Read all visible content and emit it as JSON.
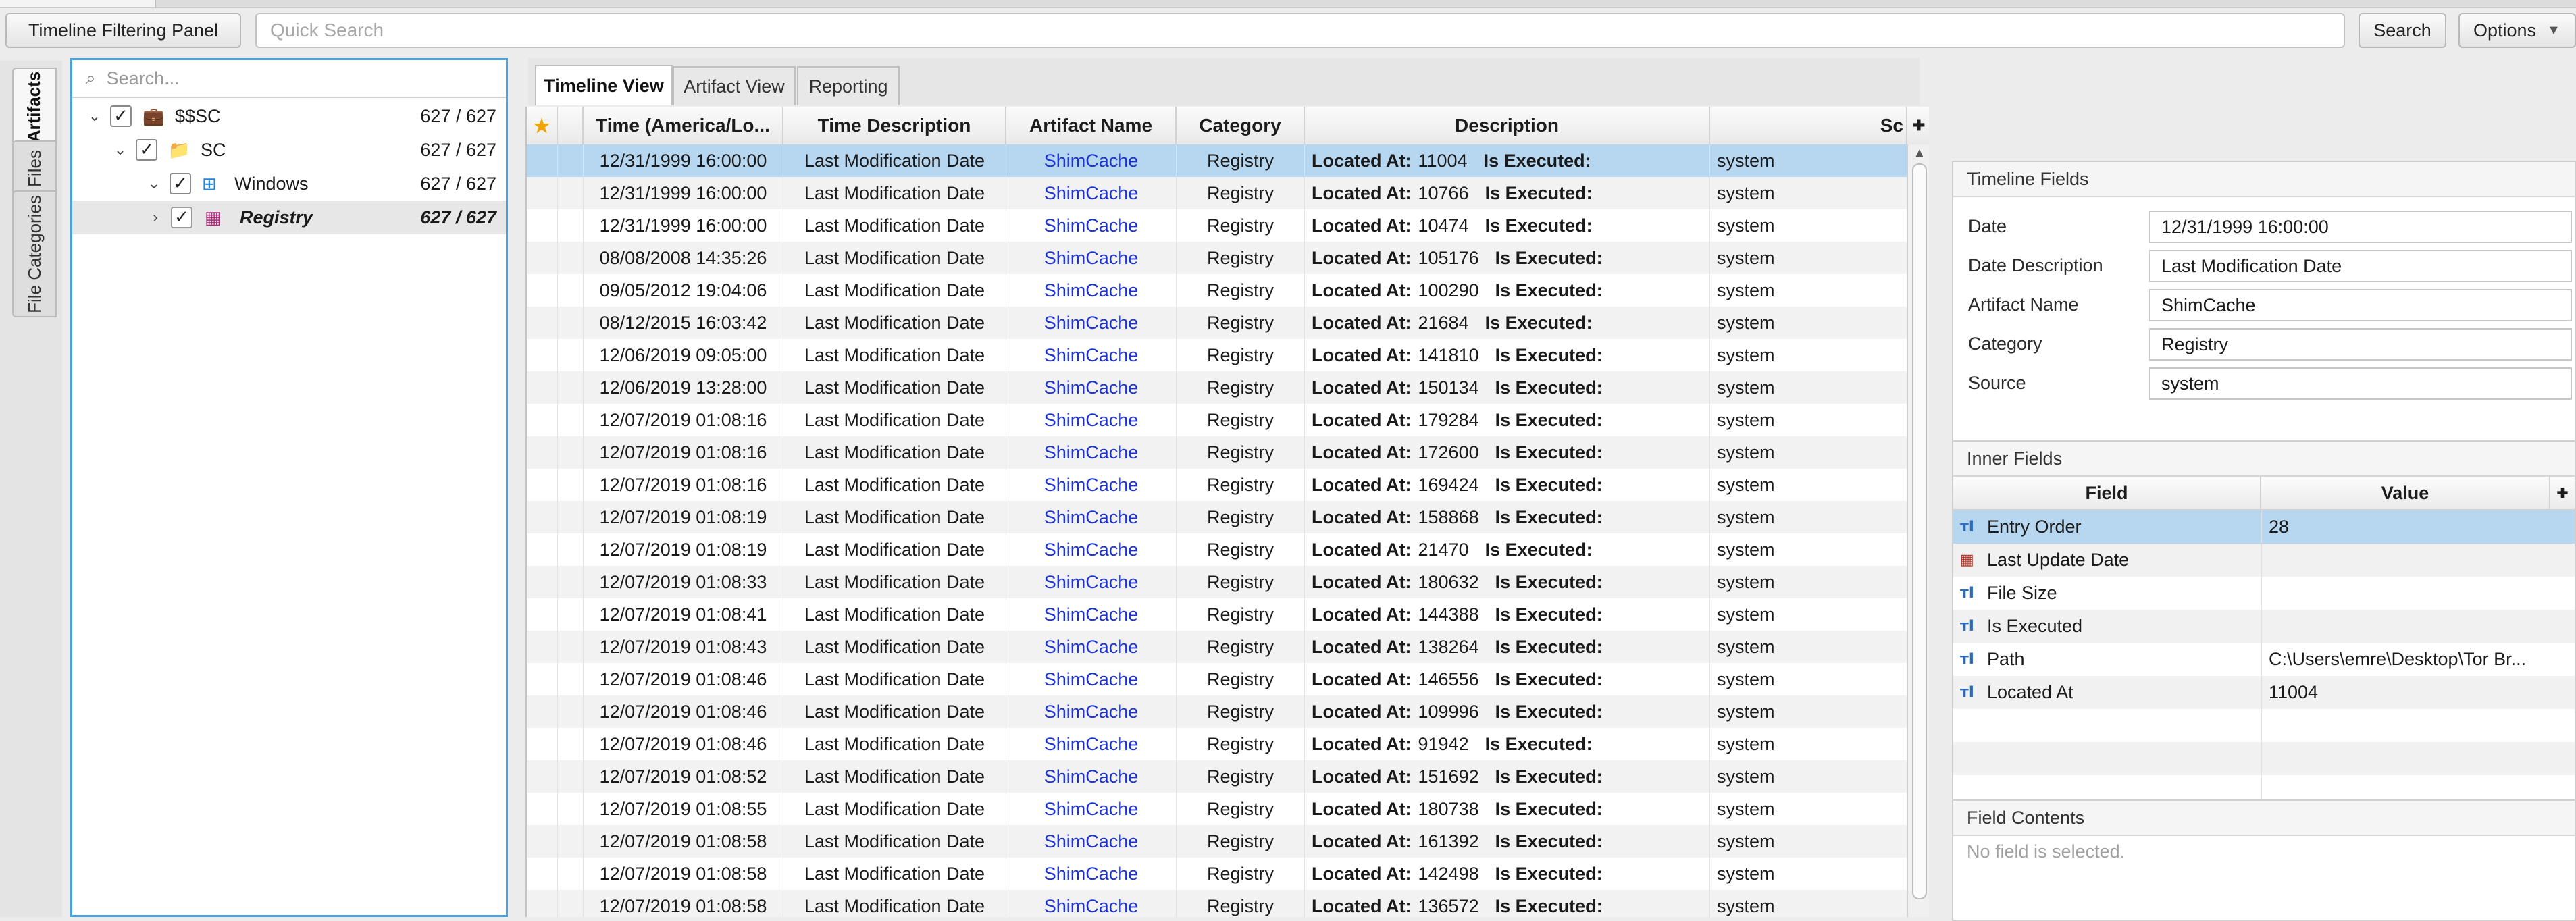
{
  "toolbar": {
    "filter_panel_label": "Timeline Filtering Panel",
    "quick_search_placeholder": "Quick Search",
    "search_label": "Search",
    "options_label": "Options"
  },
  "side_tabs": [
    "Artifacts",
    "Files",
    "File Categories"
  ],
  "tree": {
    "search_placeholder": "Search...",
    "items": [
      {
        "label": "$$SC",
        "count": "627 / 627",
        "icon": "briefcase-icon"
      },
      {
        "label": "SC",
        "count": "627 / 627",
        "icon": "folder-icon"
      },
      {
        "label": "Windows",
        "count": "627 / 627",
        "icon": "windows-logo-icon"
      },
      {
        "label": "Registry",
        "count": "627 / 627",
        "icon": "registry-icon"
      }
    ]
  },
  "center_tabs": [
    "Timeline View",
    "Artifact View",
    "Reporting"
  ],
  "table": {
    "columns": [
      "Time (America/Lo...",
      "Time Description",
      "Artifact Name",
      "Category",
      "Description",
      "Sc"
    ],
    "desc_label_located": "Located At:",
    "desc_label_executed": "Is Executed:",
    "rows": [
      {
        "time": "12/31/1999 16:00:00",
        "tdesc": "Last Modification Date",
        "artifact": "ShimCache",
        "category": "Registry",
        "located": "11004",
        "source": "system"
      },
      {
        "time": "12/31/1999 16:00:00",
        "tdesc": "Last Modification Date",
        "artifact": "ShimCache",
        "category": "Registry",
        "located": "10766",
        "source": "system"
      },
      {
        "time": "12/31/1999 16:00:00",
        "tdesc": "Last Modification Date",
        "artifact": "ShimCache",
        "category": "Registry",
        "located": "10474",
        "source": "system"
      },
      {
        "time": "08/08/2008 14:35:26",
        "tdesc": "Last Modification Date",
        "artifact": "ShimCache",
        "category": "Registry",
        "located": "105176",
        "source": "system"
      },
      {
        "time": "09/05/2012 19:04:06",
        "tdesc": "Last Modification Date",
        "artifact": "ShimCache",
        "category": "Registry",
        "located": "100290",
        "source": "system"
      },
      {
        "time": "08/12/2015 16:03:42",
        "tdesc": "Last Modification Date",
        "artifact": "ShimCache",
        "category": "Registry",
        "located": "21684",
        "source": "system"
      },
      {
        "time": "12/06/2019 09:05:00",
        "tdesc": "Last Modification Date",
        "artifact": "ShimCache",
        "category": "Registry",
        "located": "141810",
        "source": "system"
      },
      {
        "time": "12/06/2019 13:28:00",
        "tdesc": "Last Modification Date",
        "artifact": "ShimCache",
        "category": "Registry",
        "located": "150134",
        "source": "system"
      },
      {
        "time": "12/07/2019 01:08:16",
        "tdesc": "Last Modification Date",
        "artifact": "ShimCache",
        "category": "Registry",
        "located": "179284",
        "source": "system"
      },
      {
        "time": "12/07/2019 01:08:16",
        "tdesc": "Last Modification Date",
        "artifact": "ShimCache",
        "category": "Registry",
        "located": "172600",
        "source": "system"
      },
      {
        "time": "12/07/2019 01:08:16",
        "tdesc": "Last Modification Date",
        "artifact": "ShimCache",
        "category": "Registry",
        "located": "169424",
        "source": "system"
      },
      {
        "time": "12/07/2019 01:08:19",
        "tdesc": "Last Modification Date",
        "artifact": "ShimCache",
        "category": "Registry",
        "located": "158868",
        "source": "system"
      },
      {
        "time": "12/07/2019 01:08:19",
        "tdesc": "Last Modification Date",
        "artifact": "ShimCache",
        "category": "Registry",
        "located": "21470",
        "source": "system"
      },
      {
        "time": "12/07/2019 01:08:33",
        "tdesc": "Last Modification Date",
        "artifact": "ShimCache",
        "category": "Registry",
        "located": "180632",
        "source": "system"
      },
      {
        "time": "12/07/2019 01:08:41",
        "tdesc": "Last Modification Date",
        "artifact": "ShimCache",
        "category": "Registry",
        "located": "144388",
        "source": "system"
      },
      {
        "time": "12/07/2019 01:08:43",
        "tdesc": "Last Modification Date",
        "artifact": "ShimCache",
        "category": "Registry",
        "located": "138264",
        "source": "system"
      },
      {
        "time": "12/07/2019 01:08:46",
        "tdesc": "Last Modification Date",
        "artifact": "ShimCache",
        "category": "Registry",
        "located": "146556",
        "source": "system"
      },
      {
        "time": "12/07/2019 01:08:46",
        "tdesc": "Last Modification Date",
        "artifact": "ShimCache",
        "category": "Registry",
        "located": "109996",
        "source": "system"
      },
      {
        "time": "12/07/2019 01:08:46",
        "tdesc": "Last Modification Date",
        "artifact": "ShimCache",
        "category": "Registry",
        "located": "91942",
        "source": "system"
      },
      {
        "time": "12/07/2019 01:08:52",
        "tdesc": "Last Modification Date",
        "artifact": "ShimCache",
        "category": "Registry",
        "located": "151692",
        "source": "system"
      },
      {
        "time": "12/07/2019 01:08:55",
        "tdesc": "Last Modification Date",
        "artifact": "ShimCache",
        "category": "Registry",
        "located": "180738",
        "source": "system"
      },
      {
        "time": "12/07/2019 01:08:58",
        "tdesc": "Last Modification Date",
        "artifact": "ShimCache",
        "category": "Registry",
        "located": "161392",
        "source": "system"
      },
      {
        "time": "12/07/2019 01:08:58",
        "tdesc": "Last Modification Date",
        "artifact": "ShimCache",
        "category": "Registry",
        "located": "142498",
        "source": "system"
      },
      {
        "time": "12/07/2019 01:08:58",
        "tdesc": "Last Modification Date",
        "artifact": "ShimCache",
        "category": "Registry",
        "located": "136572",
        "source": "system"
      }
    ]
  },
  "timeline_fields": {
    "title": "Timeline Fields",
    "fields": [
      {
        "label": "Date",
        "value": "12/31/1999 16:00:00"
      },
      {
        "label": "Date Description",
        "value": "Last Modification Date"
      },
      {
        "label": "Artifact Name",
        "value": "ShimCache"
      },
      {
        "label": "Category",
        "value": "Registry"
      },
      {
        "label": "Source",
        "value": "system"
      }
    ]
  },
  "inner_fields": {
    "title": "Inner Fields",
    "columns": [
      "Field",
      "Value"
    ],
    "rows": [
      {
        "field": "Entry Order",
        "value": "28",
        "icon": "text-field-icon"
      },
      {
        "field": "Last Update Date",
        "value": "",
        "icon": "calendar-icon"
      },
      {
        "field": "File Size",
        "value": "",
        "icon": "text-field-icon"
      },
      {
        "field": "Is Executed",
        "value": "",
        "icon": "text-field-icon"
      },
      {
        "field": "Path",
        "value": "C:\\Users\\emre\\Desktop\\Tor Br...",
        "icon": "text-field-icon"
      },
      {
        "field": "Located At",
        "value": "11004",
        "icon": "text-field-icon"
      }
    ]
  },
  "field_contents": {
    "title": "Field Contents",
    "empty_text": "No field is selected."
  },
  "colors": {
    "selection": "#b7d7f0",
    "focus_border": "#4aa3df",
    "link": "#1b33d6"
  }
}
